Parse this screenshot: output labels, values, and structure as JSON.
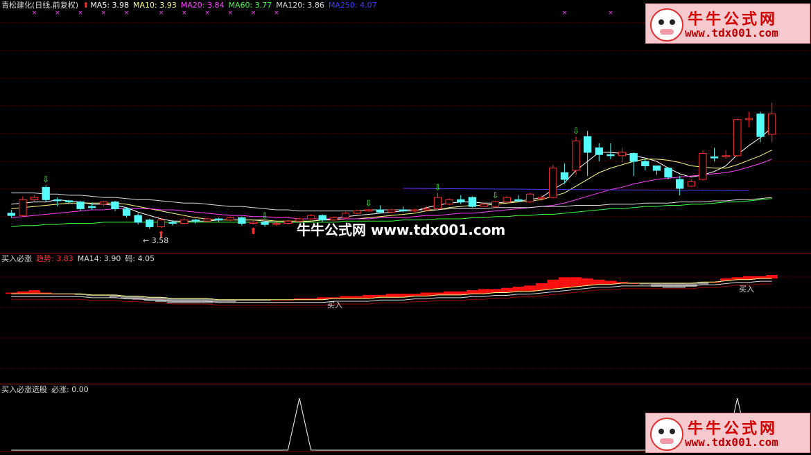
{
  "main_legend": {
    "title": "青松建化(日线,前复权)",
    "items": [
      {
        "label": "MA5: 3.98",
        "color": "#ffffff"
      },
      {
        "label": "MA10: 3.93",
        "color": "#ffff80"
      },
      {
        "label": "MA20: 3.84",
        "color": "#ff40ff"
      },
      {
        "label": "MA60: 3.77",
        "color": "#40ff40"
      },
      {
        "label": "MA120: 3.86",
        "color": "#dddddd"
      },
      {
        "label": "MA250: 4.07",
        "color": "#4040ff"
      }
    ]
  },
  "annotations": {
    "low_label": "3.58",
    "buy_label_1": "买入",
    "buy_label_2": "买入"
  },
  "indicator1_legend": {
    "title": "买入必涨",
    "items": [
      {
        "label": "趋势: 3.83",
        "color": "#ff3030"
      },
      {
        "label": "MA14: 3.90",
        "color": "#dddddd"
      },
      {
        "label": "码: 4.05",
        "color": "#dddddd"
      }
    ]
  },
  "indicator2_legend": {
    "title": "买入必涨选股",
    "items": [
      {
        "label": "必涨: 0.00",
        "color": "#dddddd"
      }
    ]
  },
  "watermark": {
    "title": "牛牛公式网",
    "url": "www.tdx001.com",
    "center_text": "牛牛公式网 www.tdx001.com"
  },
  "chart_data": [
    {
      "type": "candlestick",
      "title": "青松建化(日线,前复权)",
      "ylim": [
        3.4,
        5.5
      ],
      "candles": [
        [
          3.72,
          3.7,
          3.75,
          3.68
        ],
        [
          3.7,
          3.84,
          3.87,
          3.69
        ],
        [
          3.84,
          3.86,
          3.88,
          3.82
        ],
        [
          3.95,
          3.84,
          3.97,
          3.82
        ],
        [
          3.84,
          3.83,
          3.86,
          3.78
        ],
        [
          3.83,
          3.82,
          3.84,
          3.8
        ],
        [
          3.82,
          3.76,
          3.83,
          3.74
        ],
        [
          3.78,
          3.77,
          3.81,
          3.75
        ],
        [
          3.8,
          3.82,
          3.83,
          3.78
        ],
        [
          3.82,
          3.76,
          3.83,
          3.74
        ],
        [
          3.76,
          3.7,
          3.77,
          3.68
        ],
        [
          3.7,
          3.64,
          3.72,
          3.62
        ],
        [
          3.66,
          3.6,
          3.67,
          3.58
        ],
        [
          3.6,
          3.66,
          3.67,
          3.59
        ],
        [
          3.64,
          3.63,
          3.66,
          3.61
        ],
        [
          3.63,
          3.66,
          3.68,
          3.62
        ],
        [
          3.66,
          3.65,
          3.67,
          3.63
        ],
        [
          3.65,
          3.67,
          3.68,
          3.64
        ],
        [
          3.67,
          3.66,
          3.68,
          3.64
        ],
        [
          3.66,
          3.68,
          3.69,
          3.65
        ],
        [
          3.68,
          3.63,
          3.69,
          3.61
        ],
        [
          3.63,
          3.64,
          3.66,
          3.62
        ],
        [
          3.64,
          3.62,
          3.65,
          3.6
        ],
        [
          3.62,
          3.63,
          3.64,
          3.61
        ],
        [
          3.63,
          3.65,
          3.66,
          3.62
        ],
        [
          3.65,
          3.67,
          3.68,
          3.64
        ],
        [
          3.67,
          3.7,
          3.71,
          3.66
        ],
        [
          3.7,
          3.66,
          3.71,
          3.64
        ],
        [
          3.66,
          3.68,
          3.69,
          3.65
        ],
        [
          3.68,
          3.72,
          3.73,
          3.67
        ],
        [
          3.72,
          3.74,
          3.75,
          3.71
        ],
        [
          3.74,
          3.75,
          3.76,
          3.73
        ],
        [
          3.75,
          3.73,
          3.79,
          3.72
        ],
        [
          3.73,
          3.75,
          3.76,
          3.72
        ],
        [
          3.75,
          3.74,
          3.78,
          3.73
        ],
        [
          3.74,
          3.75,
          3.76,
          3.73
        ],
        [
          3.75,
          3.76,
          3.78,
          3.74
        ],
        [
          3.76,
          3.86,
          3.9,
          3.75
        ],
        [
          3.8,
          3.84,
          3.85,
          3.79
        ],
        [
          3.84,
          3.82,
          3.88,
          3.8
        ],
        [
          3.86,
          3.78,
          3.87,
          3.77
        ],
        [
          3.78,
          3.8,
          3.81,
          3.78
        ],
        [
          3.78,
          3.82,
          3.83,
          3.77
        ],
        [
          3.82,
          3.86,
          3.87,
          3.81
        ],
        [
          3.84,
          3.83,
          3.88,
          3.82
        ],
        [
          3.82,
          3.89,
          3.9,
          3.81
        ],
        [
          3.85,
          3.86,
          3.88,
          3.83
        ],
        [
          3.86,
          4.12,
          4.15,
          3.85
        ],
        [
          4.08,
          4.02,
          4.16,
          3.98
        ],
        [
          4.1,
          4.36,
          4.4,
          4.06
        ],
        [
          4.4,
          4.26,
          4.45,
          4.05
        ],
        [
          4.3,
          4.24,
          4.34,
          4.18
        ],
        [
          4.24,
          4.23,
          4.34,
          4.2
        ],
        [
          4.23,
          4.26,
          4.3,
          4.17
        ],
        [
          4.25,
          4.18,
          4.26,
          4.05
        ],
        [
          4.18,
          4.14,
          4.2,
          4.1
        ],
        [
          4.14,
          4.1,
          4.14,
          4.06
        ],
        [
          4.12,
          4.04,
          4.13,
          4.02
        ],
        [
          4.02,
          3.94,
          4.05,
          3.88
        ],
        [
          3.96,
          4.0,
          4.02,
          3.95
        ],
        [
          4.02,
          4.25,
          4.28,
          4.01
        ],
        [
          4.22,
          4.21,
          4.3,
          4.18
        ],
        [
          4.22,
          4.23,
          4.28,
          4.2
        ],
        [
          4.23,
          4.55,
          4.56,
          4.22
        ],
        [
          4.55,
          4.56,
          4.62,
          4.48
        ],
        [
          4.6,
          4.4,
          4.62,
          4.35
        ],
        [
          4.42,
          4.6,
          4.7,
          4.35
        ]
      ],
      "series": [
        {
          "name": "MA5",
          "values": [
            3.8,
            3.81,
            3.82,
            3.82,
            3.84,
            3.83,
            3.82,
            3.8,
            3.8,
            3.79,
            3.77,
            3.73,
            3.7,
            3.67,
            3.65,
            3.65,
            3.65,
            3.65,
            3.66,
            3.66,
            3.66,
            3.66,
            3.65,
            3.64,
            3.64,
            3.64,
            3.65,
            3.66,
            3.67,
            3.69,
            3.7,
            3.71,
            3.72,
            3.73,
            3.74,
            3.74,
            3.77,
            3.79,
            3.81,
            3.82,
            3.82,
            3.81,
            3.81,
            3.82,
            3.83,
            3.84,
            3.86,
            3.93,
            3.99,
            4.1,
            4.18,
            4.26,
            4.26,
            4.25,
            4.23,
            4.21,
            4.18,
            4.12,
            4.07,
            4.04,
            4.06,
            4.09,
            4.14,
            4.24,
            4.32,
            4.39,
            4.48
          ]
        },
        {
          "name": "MA10",
          "values": [
            3.76,
            3.77,
            3.78,
            3.79,
            3.8,
            3.81,
            3.81,
            3.81,
            3.81,
            3.81,
            3.8,
            3.78,
            3.76,
            3.74,
            3.72,
            3.7,
            3.68,
            3.67,
            3.66,
            3.66,
            3.66,
            3.66,
            3.66,
            3.65,
            3.65,
            3.65,
            3.65,
            3.66,
            3.66,
            3.67,
            3.67,
            3.68,
            3.69,
            3.7,
            3.71,
            3.72,
            3.74,
            3.75,
            3.77,
            3.78,
            3.79,
            3.79,
            3.8,
            3.81,
            3.82,
            3.83,
            3.84,
            3.87,
            3.9,
            3.96,
            4.02,
            4.08,
            4.12,
            4.15,
            4.18,
            4.2,
            4.2,
            4.19,
            4.17,
            4.14,
            4.13,
            4.12,
            4.12,
            4.15,
            4.19,
            4.23,
            4.28
          ]
        },
        {
          "name": "MA20",
          "values": [
            3.68,
            3.69,
            3.7,
            3.71,
            3.72,
            3.73,
            3.74,
            3.75,
            3.75,
            3.76,
            3.76,
            3.76,
            3.76,
            3.75,
            3.75,
            3.74,
            3.73,
            3.72,
            3.71,
            3.7,
            3.7,
            3.69,
            3.69,
            3.68,
            3.68,
            3.67,
            3.67,
            3.67,
            3.67,
            3.67,
            3.67,
            3.67,
            3.68,
            3.68,
            3.68,
            3.69,
            3.7,
            3.7,
            3.71,
            3.72,
            3.72,
            3.73,
            3.74,
            3.75,
            3.76,
            3.77,
            3.78,
            3.79,
            3.81,
            3.84,
            3.87,
            3.9,
            3.93,
            3.95,
            3.98,
            4.0,
            4.02,
            4.03,
            4.04,
            4.05,
            4.06,
            4.07,
            4.08,
            4.1,
            4.13,
            4.16,
            4.2
          ]
        },
        {
          "name": "MA60",
          "values": [
            3.6,
            3.61,
            3.61,
            3.62,
            3.62,
            3.63,
            3.63,
            3.63,
            3.64,
            3.64,
            3.64,
            3.64,
            3.64,
            3.64,
            3.64,
            3.64,
            3.64,
            3.64,
            3.64,
            3.64,
            3.64,
            3.64,
            3.64,
            3.64,
            3.64,
            3.64,
            3.64,
            3.64,
            3.64,
            3.65,
            3.65,
            3.65,
            3.65,
            3.65,
            3.66,
            3.66,
            3.66,
            3.67,
            3.67,
            3.67,
            3.68,
            3.68,
            3.69,
            3.69,
            3.7,
            3.7,
            3.71,
            3.71,
            3.72,
            3.73,
            3.74,
            3.75,
            3.76,
            3.76,
            3.77,
            3.78,
            3.78,
            3.79,
            3.79,
            3.8,
            3.8,
            3.81,
            3.82,
            3.82,
            3.83,
            3.84,
            3.85
          ]
        },
        {
          "name": "MA120",
          "values": [
            3.9,
            3.9,
            3.9,
            3.89,
            3.89,
            3.88,
            3.88,
            3.87,
            3.86,
            3.86,
            3.85,
            3.84,
            3.84,
            3.83,
            3.82,
            3.81,
            3.81,
            3.8,
            3.79,
            3.78,
            3.78,
            3.77,
            3.76,
            3.75,
            3.75,
            3.74,
            3.74,
            3.74,
            3.74,
            3.74,
            3.74,
            3.75,
            3.75,
            3.75,
            3.75,
            3.75,
            3.75,
            3.75,
            3.76,
            3.76,
            3.76,
            3.76,
            3.77,
            3.77,
            3.77,
            3.77,
            3.78,
            3.78,
            3.78,
            3.79,
            3.79,
            3.79,
            3.8,
            3.8,
            3.8,
            3.81,
            3.81,
            3.81,
            3.82,
            3.82,
            3.82,
            3.83,
            3.83,
            3.84,
            3.84,
            3.85,
            3.86
          ]
        },
        {
          "name": "MA250",
          "points": [
            [
              34,
              3.94
            ],
            [
              64,
              3.92
            ]
          ]
        }
      ]
    },
    {
      "type": "area",
      "title": "买入必涨",
      "ylim": [
        0,
        100
      ],
      "trend": [
        75,
        76,
        77,
        75,
        74,
        74,
        73,
        72,
        72,
        71,
        70,
        69,
        68,
        67,
        66,
        66,
        66,
        66,
        67,
        67,
        68,
        68,
        68,
        69,
        69,
        70,
        70,
        71,
        71,
        72,
        72,
        73,
        73,
        74,
        74,
        74,
        75,
        75,
        76,
        76,
        77,
        78,
        78,
        79,
        80,
        81,
        83,
        86,
        88,
        88,
        87,
        86,
        85,
        84,
        83,
        82,
        80,
        79,
        79,
        80,
        82,
        84,
        87,
        88,
        89,
        89,
        90
      ],
      "ma14": [
        74,
        74,
        74,
        74,
        74,
        74,
        74,
        73,
        73,
        73,
        72,
        72,
        71,
        71,
        70,
        70,
        70,
        70,
        69,
        69,
        69,
        69,
        69,
        69,
        69,
        69,
        69,
        69,
        70,
        70,
        70,
        70,
        71,
        71,
        71,
        72,
        72,
        73,
        73,
        73,
        74,
        74,
        75,
        75,
        76,
        76,
        77,
        78,
        79,
        80,
        81,
        82,
        82,
        83,
        83,
        83,
        83,
        83,
        83,
        83,
        84,
        84,
        85,
        86,
        86,
        87,
        87
      ]
    },
    {
      "type": "line",
      "title": "买入必涨选股",
      "name": "必涨",
      "ylim": [
        0,
        1
      ],
      "values": [
        0,
        0,
        0,
        0,
        0,
        0,
        0,
        0,
        0,
        0,
        0,
        0,
        0,
        0,
        0,
        0,
        0,
        0,
        0,
        0,
        0,
        0,
        0,
        0,
        0,
        1,
        0,
        0,
        0,
        0,
        0,
        0,
        0,
        0,
        0,
        0,
        0,
        0,
        0,
        0,
        0,
        0,
        0,
        0,
        0,
        0,
        0,
        0,
        0,
        0,
        0,
        0,
        0,
        0,
        0,
        0,
        0,
        0,
        0,
        0,
        0,
        0,
        0,
        1,
        0,
        0,
        0
      ]
    }
  ]
}
